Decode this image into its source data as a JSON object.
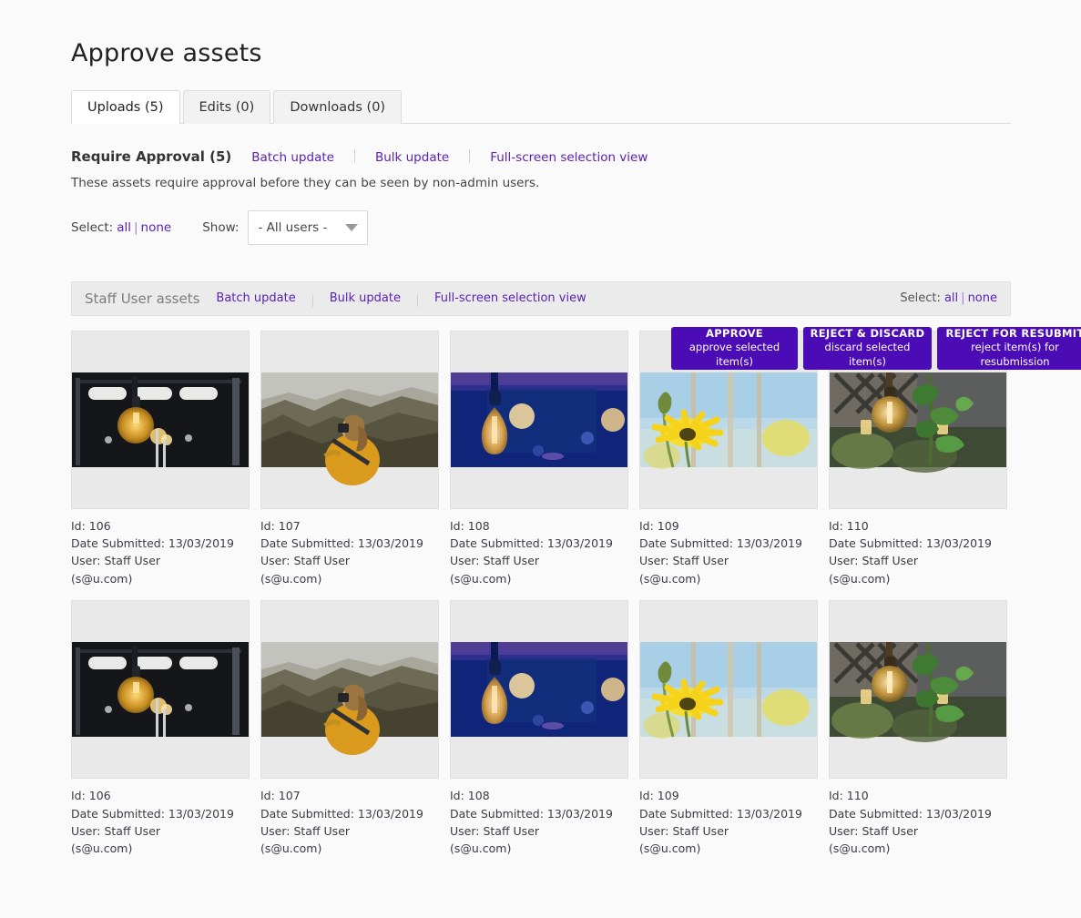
{
  "page": {
    "title": "Approve assets"
  },
  "tabs": [
    {
      "label": "Uploads (5)",
      "active": true
    },
    {
      "label": "Edits (0)",
      "active": false
    },
    {
      "label": "Downloads (0)",
      "active": false
    }
  ],
  "require_approval": {
    "title": "Require Approval (5)",
    "links": [
      "Batch update",
      "Bulk update",
      "Full-screen selection view"
    ],
    "description": "These assets require approval before they can be seen by non-admin users."
  },
  "controls": {
    "select_label": "Select:",
    "select_all": "all",
    "select_pipe": "|",
    "select_none": "none",
    "show_label": "Show:",
    "show_value": "- All users -"
  },
  "actions": [
    {
      "title": "APPROVE",
      "subtitle": "approve selected item(s)"
    },
    {
      "title": "REJECT & DISCARD",
      "subtitle": "discard selected item(s)"
    },
    {
      "title": "REJECT FOR RESUBMIT",
      "subtitle": "reject item(s) for resubmission"
    }
  ],
  "group": {
    "title": "Staff User assets",
    "links": [
      "Batch update",
      "Bulk update",
      "Full-screen selection view"
    ],
    "select_label": "Select:",
    "select_all": "all",
    "select_pipe": "|",
    "select_none": "none"
  },
  "assets": [
    {
      "id": "Id: 106",
      "date": "Date Submitted: 13/03/2019",
      "user": "User: Staff User",
      "email": "(s@u.com)",
      "image": "edison-bulbs-dark-window"
    },
    {
      "id": "Id: 107",
      "date": "Date Submitted: 13/03/2019",
      "user": "User: Staff User",
      "email": "(s@u.com)",
      "image": "photographer-yellow-sweater-rocks"
    },
    {
      "id": "Id: 108",
      "date": "Date Submitted: 13/03/2019",
      "user": "User: Staff User",
      "email": "(s@u.com)",
      "image": "edison-bulb-blue-bokeh"
    },
    {
      "id": "Id: 109",
      "date": "Date Submitted: 13/03/2019",
      "user": "User: Staff User",
      "email": "(s@u.com)",
      "image": "yellow-daisy-blue-sky"
    },
    {
      "id": "Id: 110",
      "date": "Date Submitted: 13/03/2019",
      "user": "User: Staff User",
      "email": "(s@u.com)",
      "image": "bulb-green-leaves-trellis"
    },
    {
      "id": "Id: 106",
      "date": "Date Submitted: 13/03/2019",
      "user": "User: Staff User",
      "email": "(s@u.com)",
      "image": "edison-bulbs-dark-window"
    },
    {
      "id": "Id: 107",
      "date": "Date Submitted: 13/03/2019",
      "user": "User: Staff User",
      "email": "(s@u.com)",
      "image": "photographer-yellow-sweater-rocks"
    },
    {
      "id": "Id: 108",
      "date": "Date Submitted: 13/03/2019",
      "user": "User: Staff User",
      "email": "(s@u.com)",
      "image": "edison-bulb-blue-bokeh"
    },
    {
      "id": "Id: 109",
      "date": "Date Submitted: 13/03/2019",
      "user": "User: Staff User",
      "email": "(s@u.com)",
      "image": "yellow-daisy-blue-sky"
    },
    {
      "id": "Id: 110",
      "date": "Date Submitted: 13/03/2019",
      "user": "User: Staff User",
      "email": "(s@u.com)",
      "image": "bulb-green-leaves-trellis"
    }
  ],
  "colors": {
    "accent": "#4B0BB5",
    "link": "#5b21b6",
    "page_bg": "#fafafa",
    "tile_bg": "#e9e9e9"
  }
}
